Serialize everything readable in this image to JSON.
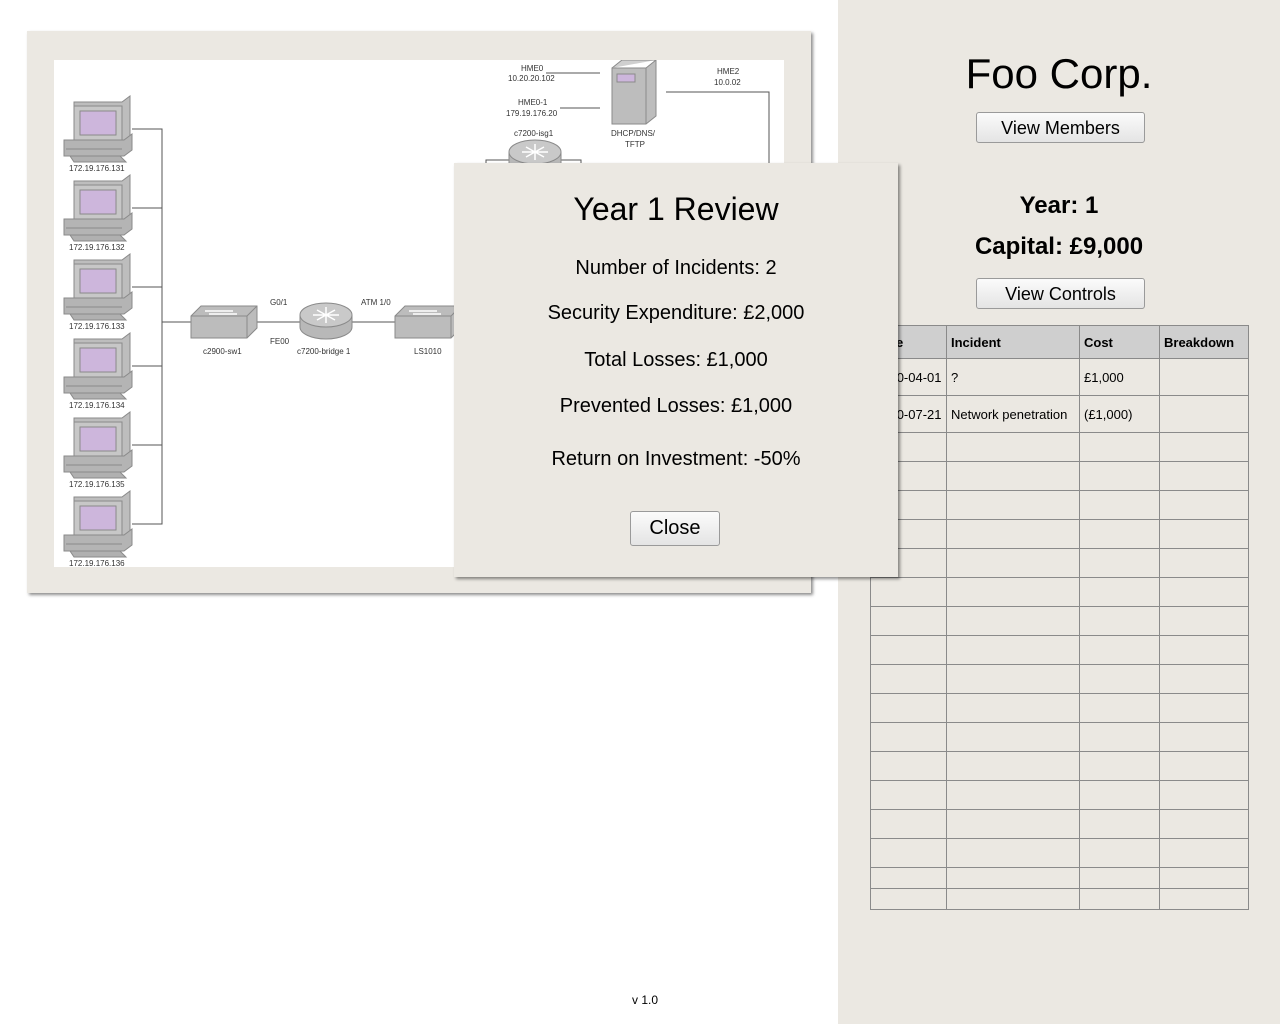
{
  "company": {
    "name": "Foo Corp.",
    "view_members_label": "View Members"
  },
  "status": {
    "year_text": "Year: 1",
    "capital_text": "Capital: £9,000"
  },
  "controls": {
    "view_controls_label": "View Controls"
  },
  "incident_table": {
    "headers": [
      "Date",
      "Incident",
      "Cost",
      "Breakdown"
    ],
    "rows": [
      [
        "2000-04-01",
        "?",
        "£1,000",
        ""
      ],
      [
        "2000-07-21",
        "Network penetration",
        "(£1,000)",
        ""
      ]
    ]
  },
  "network_map": {
    "hosts": [
      "172.19.176.131",
      "172.19.176.132",
      "172.19.176.133",
      "172.19.176.134",
      "172.19.176.135",
      "172.19.176.136"
    ],
    "switch_label": "c2900-sw1",
    "bridge_label": "c7200-bridge 1",
    "ls_label": "LS1010",
    "g01_label": "G0/1",
    "fe00_label": "FE00",
    "atm_label": "ATM 1/0",
    "server_label_1": "DHCP/DNS/",
    "server_label_2": "TFTP",
    "hme0_label": "HME0",
    "hme0_ip": "10.20.20.102",
    "hme01_label": "HME0-1",
    "hme01_ip": "179.19.176.20",
    "hme2_label": "HME2",
    "hme2_ip": "10.0.02",
    "router_label": "c7200-isg1"
  },
  "review_modal": {
    "title": "Year 1 Review",
    "incidents": "Number of Incidents: 2",
    "expenditure": "Security Expenditure: £2,000",
    "losses": "Total Losses: £1,000",
    "prevented": "Prevented Losses: £1,000",
    "roi": "Return on Investment: -50%",
    "close_label": "Close"
  },
  "version": "v 1.0"
}
